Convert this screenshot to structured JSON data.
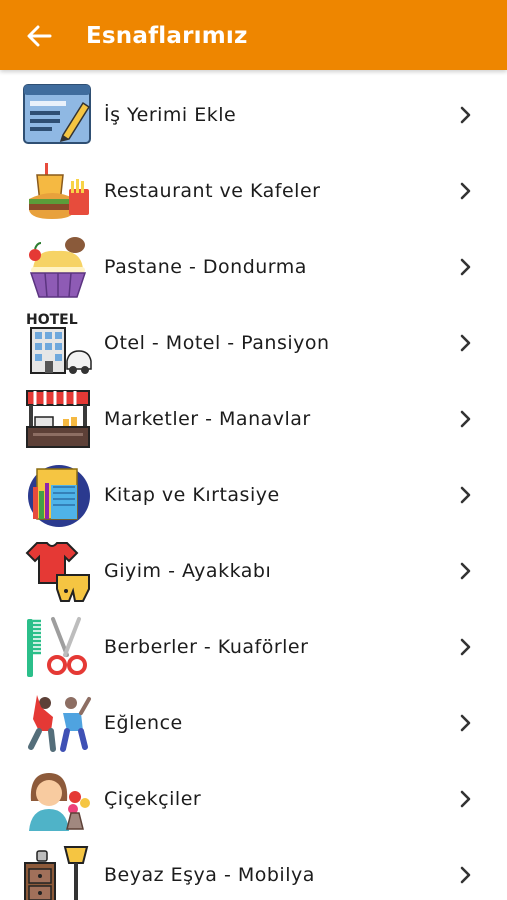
{
  "appbar": {
    "title": "Esnaflarımız",
    "back_icon": "arrow-left-icon",
    "background": "#ee8600"
  },
  "categories": [
    {
      "label": "İş Yerimi Ekle",
      "icon": "add-business-icon"
    },
    {
      "label": "Restaurant ve Kafeler",
      "icon": "fast-food-icon"
    },
    {
      "label": "Pastane - Dondurma",
      "icon": "cupcake-icon"
    },
    {
      "label": "Otel - Motel - Pansiyon",
      "icon": "hotel-icon"
    },
    {
      "label": "Marketler - Manavlar",
      "icon": "market-stall-icon"
    },
    {
      "label": "Kitap ve Kırtasiye",
      "icon": "books-icon"
    },
    {
      "label": "Giyim - Ayakkabı",
      "icon": "clothing-icon"
    },
    {
      "label": "Berberler - Kuaförler",
      "icon": "comb-scissors-icon"
    },
    {
      "label": "Eğlence",
      "icon": "dancing-people-icon"
    },
    {
      "label": "Çiçekçiler",
      "icon": "florist-icon"
    },
    {
      "label": "Beyaz Eşya - Mobilya",
      "icon": "furniture-icon"
    }
  ]
}
